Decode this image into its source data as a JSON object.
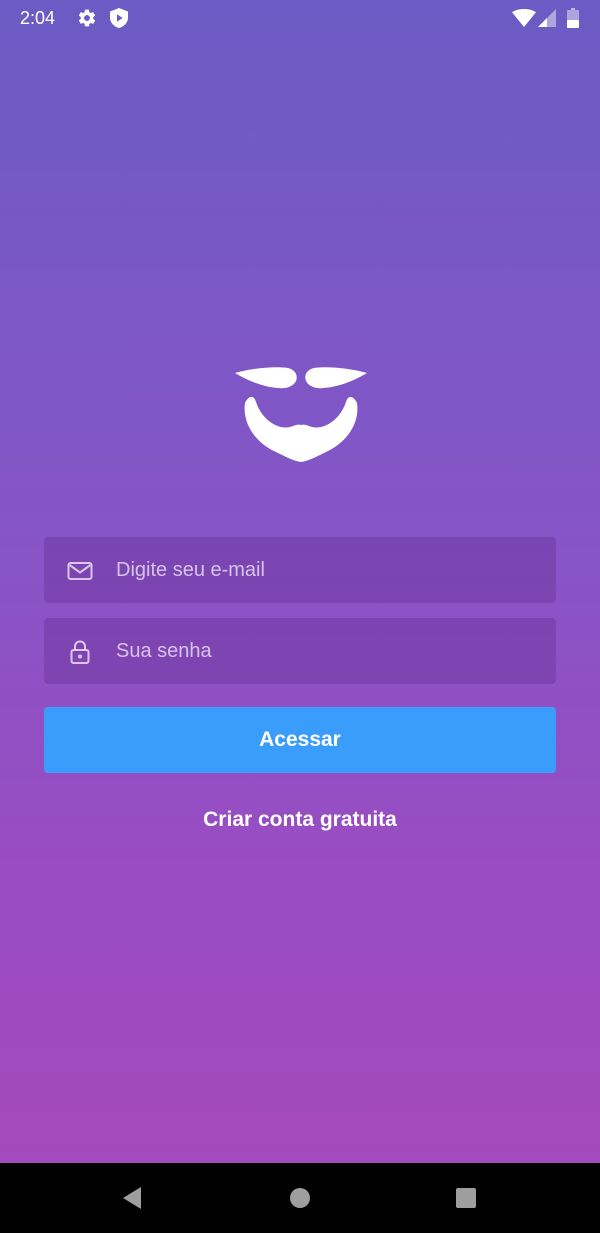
{
  "status_bar": {
    "time": "2:04",
    "icons": [
      "settings-icon",
      "shield-icon",
      "wifi-icon",
      "signal-icon",
      "battery-icon"
    ]
  },
  "logo": {
    "icon": "beard-mustache-logo",
    "color": "#ffffff"
  },
  "form": {
    "email": {
      "placeholder": "Digite seu e-mail",
      "value": "",
      "icon": "mail-icon"
    },
    "password": {
      "placeholder": "Sua senha",
      "value": "",
      "icon": "lock-icon"
    },
    "submit_label": "Acessar",
    "create_account_label": "Criar conta gratuita"
  },
  "navigation_bar": {
    "buttons": [
      "back-icon",
      "home-icon",
      "recents-icon"
    ]
  },
  "colors": {
    "gradient_top": "#6c5bc4",
    "gradient_bottom": "#a34abd",
    "button": "#3a9dfc",
    "text": "#ffffff"
  }
}
